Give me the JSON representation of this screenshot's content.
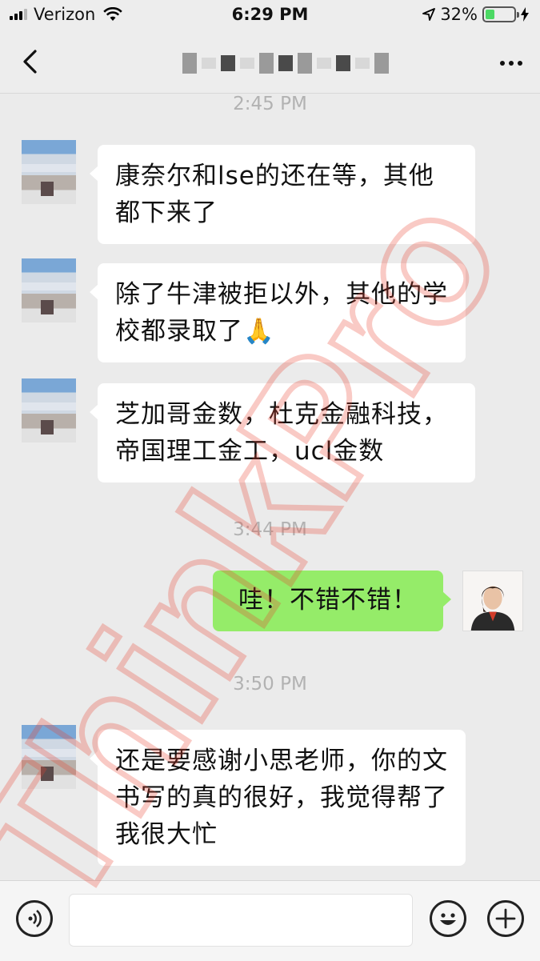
{
  "status_bar": {
    "carrier": "Verizon",
    "time": "6:29 PM",
    "battery": "32%",
    "battery_level": 0.32
  },
  "nav": {
    "back_icon": "chevron-left-icon",
    "more_icon": "ellipsis-icon"
  },
  "messages": {
    "ts1": "2:45 PM",
    "m1": "康奈尔和lse的还在等，其他都下来了",
    "m2": "除了牛津被拒以外，其他的学校都录取了🙏",
    "m3": "芝加哥金数，杜克金融科技，帝国理工金工，ucl金数",
    "ts2": "3:44 PM",
    "m4": "哇！不错不错！",
    "ts3": "3:50 PM",
    "m5": "还是要感谢小思老师，你的文书写的真的很好，我觉得帮了我很大忙"
  },
  "input_bar": {
    "voice_icon": "voice-icon",
    "emoji_icon": "emoji-icon",
    "add_icon": "plus-icon"
  },
  "watermark": {
    "text": "ThinkPro",
    "color": "#e8412f"
  }
}
